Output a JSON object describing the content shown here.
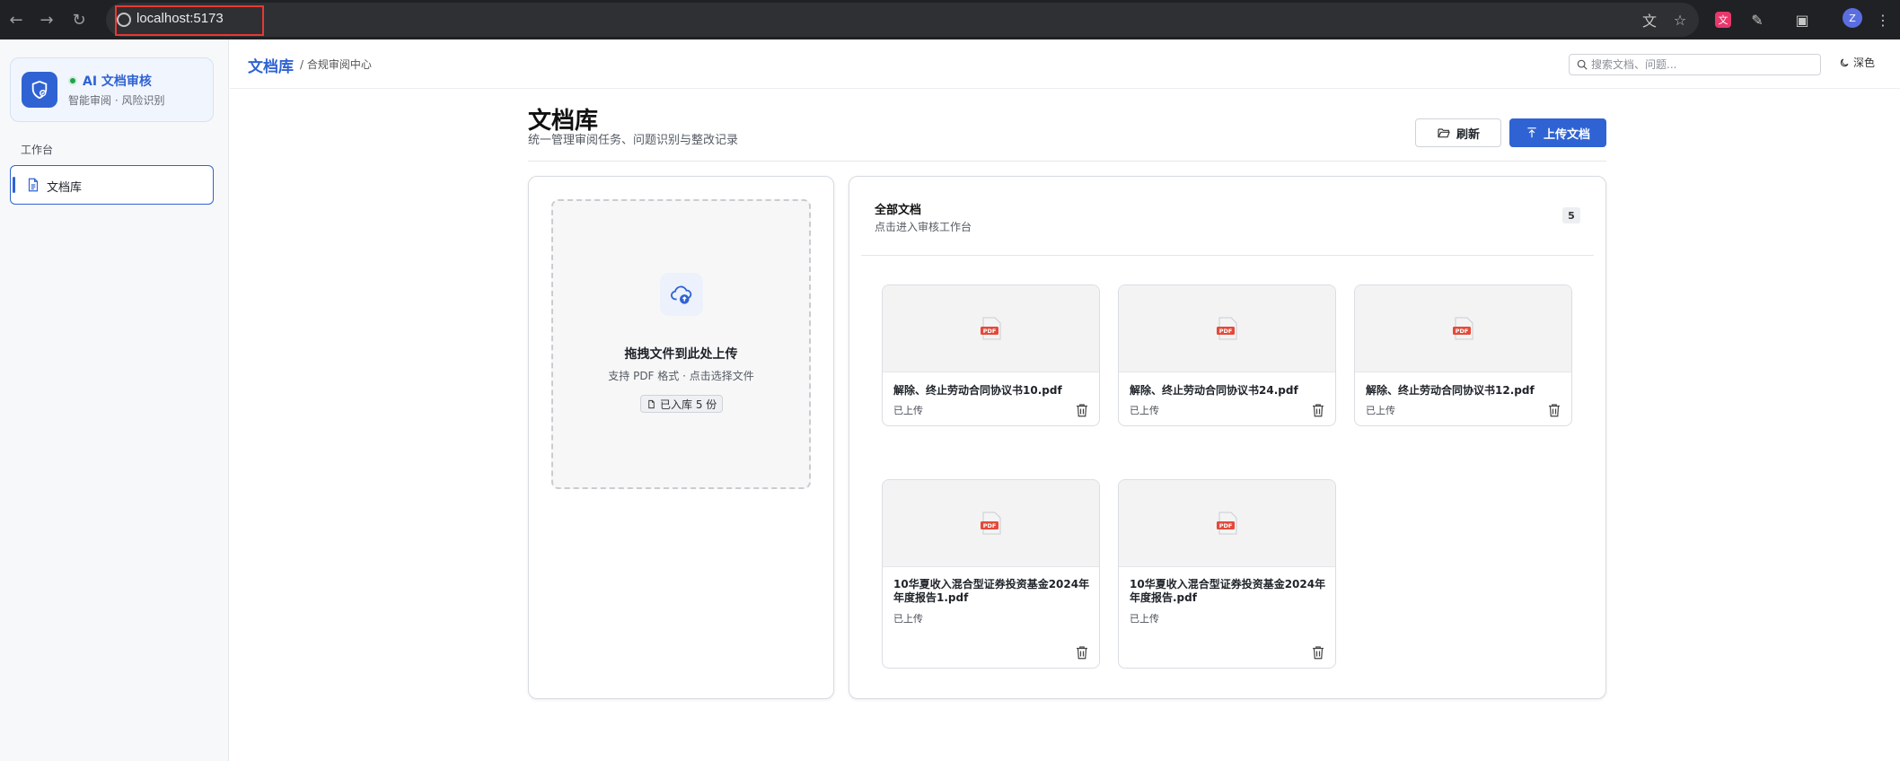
{
  "browser": {
    "url": "localhost:5173"
  },
  "sidebar": {
    "brand": {
      "title": "AI 文档审核",
      "subtitle": "智能审阅 · 风险识别"
    },
    "section_label": "工作台",
    "items": [
      {
        "label": "文档库",
        "active": true
      }
    ]
  },
  "header": {
    "breadcrumb_main": "文档库",
    "breadcrumb_sub": "/ 合规审阅中心",
    "search_placeholder": "搜索文档、问题...",
    "theme_label": "深色"
  },
  "page": {
    "title": "文档库",
    "subtitle": "统一管理审阅任务、问题识别与整改记录",
    "refresh_label": "刷新",
    "upload_label": "上传文档"
  },
  "upload": {
    "title": "拖拽文件到此处上传",
    "subtitle": "支持 PDF 格式 · 点击选择文件",
    "badge": "已入库 5 份"
  },
  "docs": {
    "title": "全部文档",
    "subtitle": "点击进入审核工作台",
    "count": "5",
    "items": [
      {
        "name": "解除、终止劳动合同协议书10.pdf",
        "status": "已上传"
      },
      {
        "name": "解除、终止劳动合同协议书24.pdf",
        "status": "已上传"
      },
      {
        "name": "解除、终止劳动合同协议书12.pdf",
        "status": "已上传"
      },
      {
        "name": "10华夏收入混合型证券投资基金2024年年度报告1.pdf",
        "status": "已上传"
      },
      {
        "name": "10华夏收入混合型证券投资基金2024年年度报告.pdf",
        "status": "已上传"
      }
    ]
  },
  "colors": {
    "accent": "#2f63d3",
    "pdf_red": "#e34a3a",
    "status_green": "#1fa34a"
  }
}
